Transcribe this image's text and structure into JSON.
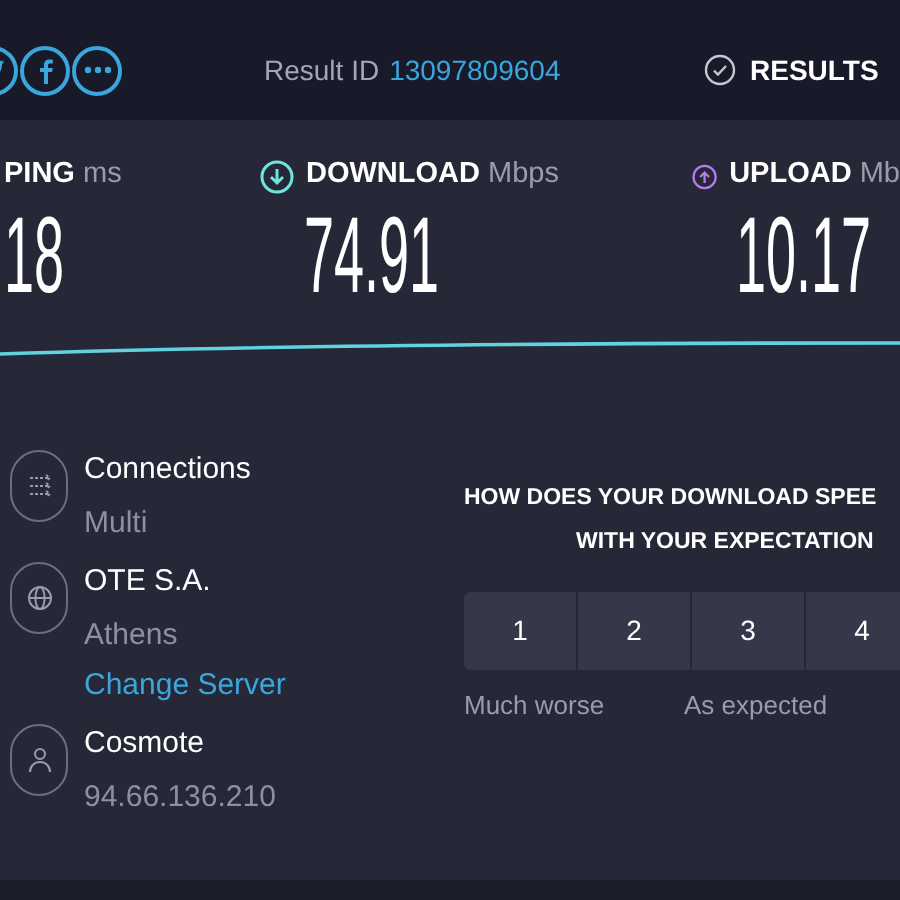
{
  "header": {
    "result_label": "Result ID",
    "result_id": "13097809604",
    "results_button": "RESULTS"
  },
  "metrics": [
    {
      "kind": "ping",
      "label": "PING",
      "unit": "ms",
      "value": "18"
    },
    {
      "kind": "download",
      "label": "DOWNLOAD",
      "unit": "Mbps",
      "value": "74.91"
    },
    {
      "kind": "upload",
      "label": "UPLOAD",
      "unit": "Mb",
      "value": "10.17"
    }
  ],
  "server_info": [
    {
      "kind": "connections",
      "title": "Connections",
      "subtitle": "Multi"
    },
    {
      "kind": "server",
      "title": "OTE S.A.",
      "subtitle": "Athens",
      "link": "Change Server"
    },
    {
      "kind": "provider",
      "title": "Cosmote",
      "subtitle": "94.66.136.210"
    }
  ],
  "survey": {
    "question_lines": [
      "HOW DOES YOUR DOWNLOAD SPEE",
      "WITH YOUR EXPECTATION"
    ],
    "ratings": [
      "1",
      "2",
      "3",
      "4"
    ],
    "scale_labels": [
      "Much worse",
      "As expected"
    ]
  }
}
